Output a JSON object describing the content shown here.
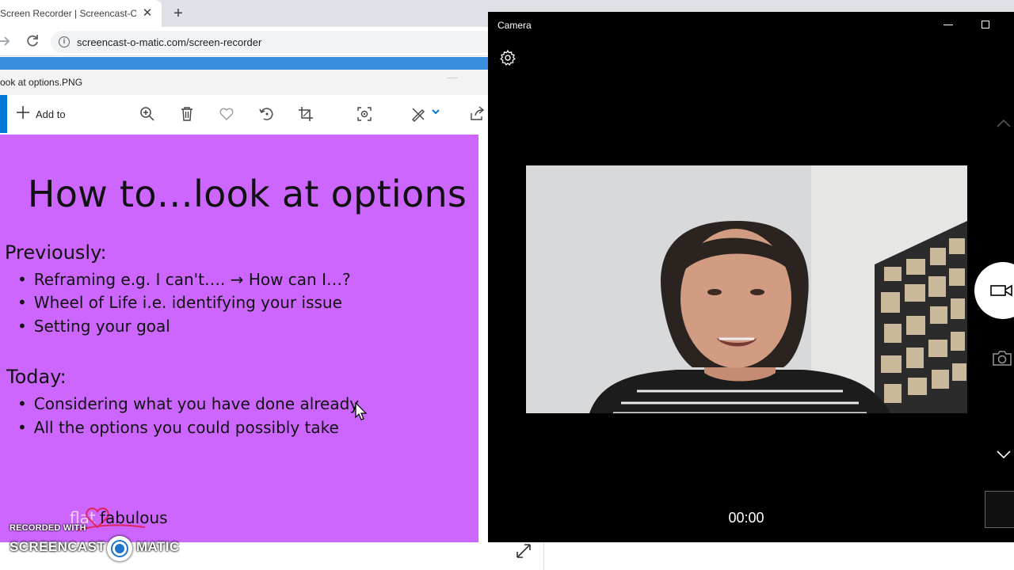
{
  "browser": {
    "tab_title": "Screen Recorder | Screencast-O-M",
    "tab_close": "✕",
    "new_tab": "+",
    "url": "screencast-o-matic.com/screen-recorder"
  },
  "photos": {
    "window_title": "ook at options.PNG",
    "toolbar": {
      "add_to_label": "Add to",
      "icons": [
        "zoom-in-icon",
        "delete-icon",
        "favorite-icon",
        "rotate-icon",
        "crop-icon",
        "enhance-icon",
        "edit-draw-icon",
        "share-icon"
      ]
    },
    "slide": {
      "title": "How to…look at options",
      "previously_heading": "Previously:",
      "previously_items": [
        "Reframing e.g. I can't…. → How can I…?",
        "Wheel of Life i.e. identifying your issue",
        "Setting your goal"
      ],
      "today_heading": "Today:",
      "today_items": [
        "Considering what you have done already",
        "All the options you could possibly take"
      ],
      "logo_left": "flat",
      "logo_right": "fabulous"
    }
  },
  "watermark": {
    "line1": "RECORDED WITH",
    "brand_left": "SCREENCAST",
    "brand_right": "MATIC"
  },
  "camera": {
    "title": "Camera",
    "timer": "00:00"
  },
  "colors": {
    "slide_bg": "#cc66ff",
    "accent": "#0078d7",
    "browser_accent": "#3b8ee0",
    "camera_bg": "#000000"
  }
}
